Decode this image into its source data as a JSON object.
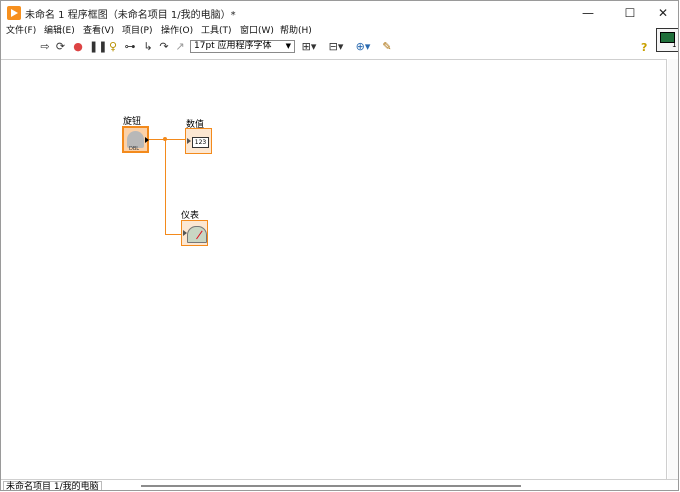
{
  "window": {
    "title": "未命名 1 程序框图（未命名项目 1/我的电脑）*",
    "controls": {
      "minimize": "—",
      "maximize": "☐",
      "close": "✕"
    }
  },
  "menu": [
    {
      "label": "文件(F)"
    },
    {
      "label": "编辑(E)"
    },
    {
      "label": "查看(V)"
    },
    {
      "label": "项目(P)"
    },
    {
      "label": "操作(O)"
    },
    {
      "label": "工具(T)"
    },
    {
      "label": "窗口(W)"
    },
    {
      "label": "帮助(H)"
    }
  ],
  "toolbar": {
    "font": "17pt 应用程序字体",
    "help": "?",
    "context_number": "1",
    "icons": [
      "run-arrow-icon",
      "run-continuously-icon",
      "abort-icon",
      "pause-icon",
      "highlight-execution-icon",
      "retain-wire-values-icon",
      "step-into-icon",
      "step-over-icon",
      "step-out-icon",
      "align-objects-icon",
      "distribute-objects-icon",
      "reorder-icon",
      "cleanup-diagram-icon"
    ]
  },
  "diagram": {
    "knob_label": "旋钮",
    "numeric_label": "数值",
    "gauge_label": "仪表",
    "knob_tag": "DBL",
    "numeric_display": "123",
    "wire_color": "#f38a1c"
  },
  "status": {
    "project": "未命名项目 1/我的电脑"
  }
}
